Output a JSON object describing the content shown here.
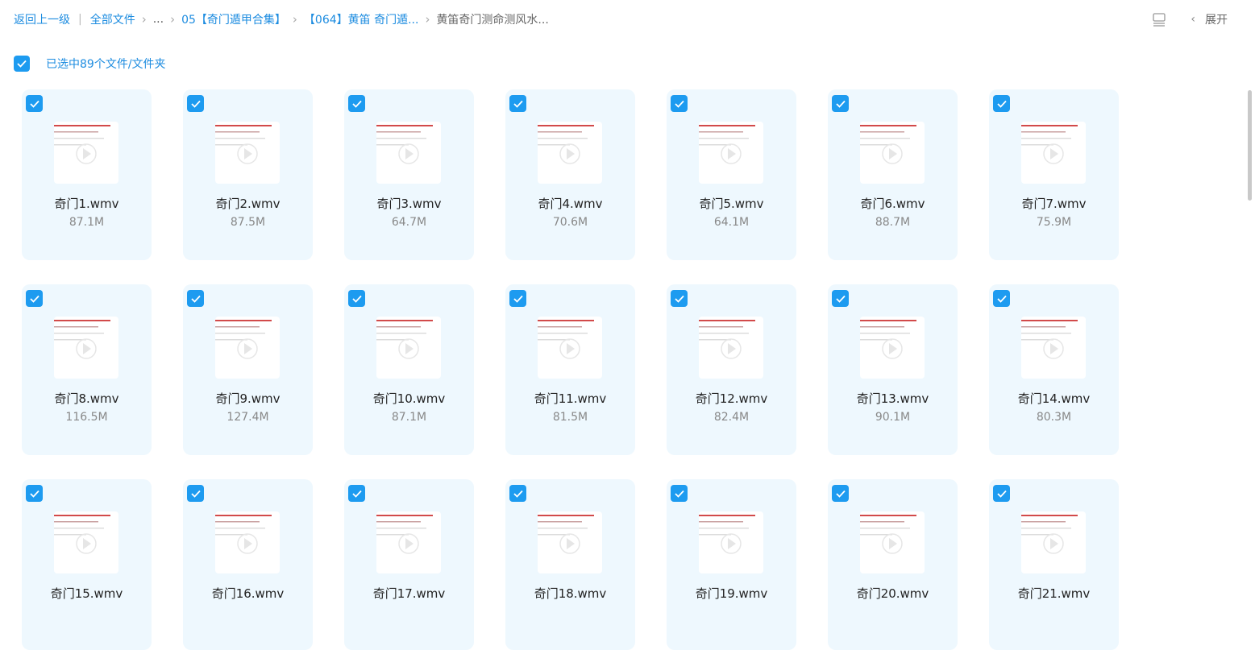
{
  "breadcrumb": {
    "back": "返回上一级",
    "all_files": "全部文件",
    "ellipsis": "...",
    "level1": "05【奇门遁甲合集】",
    "level2": "【064】黄笛 奇门遁...",
    "current": "黄笛奇门测命测风水..."
  },
  "toolbar": {
    "expand_label": "展开"
  },
  "selection": {
    "text": "已选中89个文件/文件夹"
  },
  "colors": {
    "accent": "#1d9bf0",
    "card_bg": "#eef8fe",
    "link": "#1d8ce0"
  },
  "files": [
    {
      "name": "奇门1.wmv",
      "size": "87.1M"
    },
    {
      "name": "奇门2.wmv",
      "size": "87.5M"
    },
    {
      "name": "奇门3.wmv",
      "size": "64.7M"
    },
    {
      "name": "奇门4.wmv",
      "size": "70.6M"
    },
    {
      "name": "奇门5.wmv",
      "size": "64.1M"
    },
    {
      "name": "奇门6.wmv",
      "size": "88.7M"
    },
    {
      "name": "奇门7.wmv",
      "size": "75.9M"
    },
    {
      "name": "奇门8.wmv",
      "size": "116.5M"
    },
    {
      "name": "奇门9.wmv",
      "size": "127.4M"
    },
    {
      "name": "奇门10.wmv",
      "size": "87.1M"
    },
    {
      "name": "奇门11.wmv",
      "size": "81.5M"
    },
    {
      "name": "奇门12.wmv",
      "size": "82.4M"
    },
    {
      "name": "奇门13.wmv",
      "size": "90.1M"
    },
    {
      "name": "奇门14.wmv",
      "size": "80.3M"
    },
    {
      "name": "奇门15.wmv",
      "size": ""
    },
    {
      "name": "奇门16.wmv",
      "size": ""
    },
    {
      "name": "奇门17.wmv",
      "size": ""
    },
    {
      "name": "奇门18.wmv",
      "size": ""
    },
    {
      "name": "奇门19.wmv",
      "size": ""
    },
    {
      "name": "奇门20.wmv",
      "size": ""
    },
    {
      "name": "奇门21.wmv",
      "size": ""
    }
  ]
}
